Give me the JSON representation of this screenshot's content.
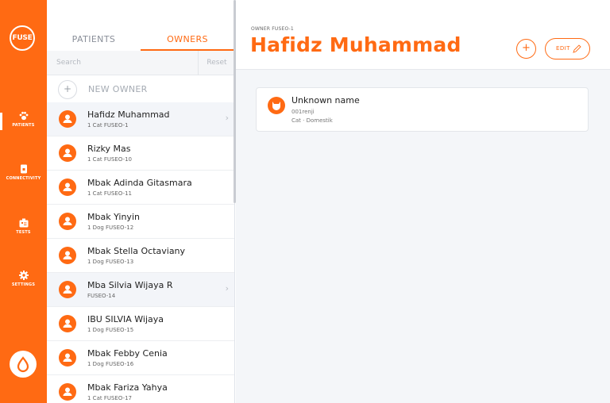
{
  "nav": {
    "logo": "FUSE",
    "items": [
      {
        "label": "PATIENTS",
        "icon": "paw-icon"
      },
      {
        "label": "CONNECTIVITY",
        "icon": "device-icon"
      },
      {
        "label": "TESTS",
        "icon": "test-kit-icon"
      },
      {
        "label": "SETTINGS",
        "icon": "gear-icon"
      }
    ],
    "accent": "#ff6a13"
  },
  "list": {
    "tabs": {
      "patients": "PATIENTS",
      "owners": "OWNERS"
    },
    "search_placeholder": "Search",
    "reset_label": "Reset",
    "new_owner_label": "NEW OWNER",
    "owners": [
      {
        "name": "Hafidz Muhammad",
        "sub": "1 Cat FUSEO-1"
      },
      {
        "name": "Rizky Mas",
        "sub": "1 Cat FUSEO-10"
      },
      {
        "name": "Mbak Adinda Gitasmara",
        "sub": "1 Cat FUSEO-11"
      },
      {
        "name": "Mbak Yinyin",
        "sub": "1 Dog FUSEO-12"
      },
      {
        "name": "Mbak Stella Octaviany",
        "sub": "1 Dog FUSEO-13"
      },
      {
        "name": "Mba Silvia Wijaya R",
        "sub": "FUSEO-14"
      },
      {
        "name": "IBU SILVIA Wijaya",
        "sub": "1 Dog FUSEO-15"
      },
      {
        "name": "Mbak Febby Cenia",
        "sub": "1 Dog FUSEO-16"
      },
      {
        "name": "Mbak Fariza Yahya",
        "sub": "1 Cat FUSEO-17"
      }
    ]
  },
  "main": {
    "kicker": "OWNER FUSEO-1",
    "title": "Hafidz Muhammad",
    "add_label": "+",
    "edit_label": "EDIT",
    "pet": {
      "name": "Unknown name",
      "id": "001renji",
      "type": "Cat · Domestik"
    }
  }
}
